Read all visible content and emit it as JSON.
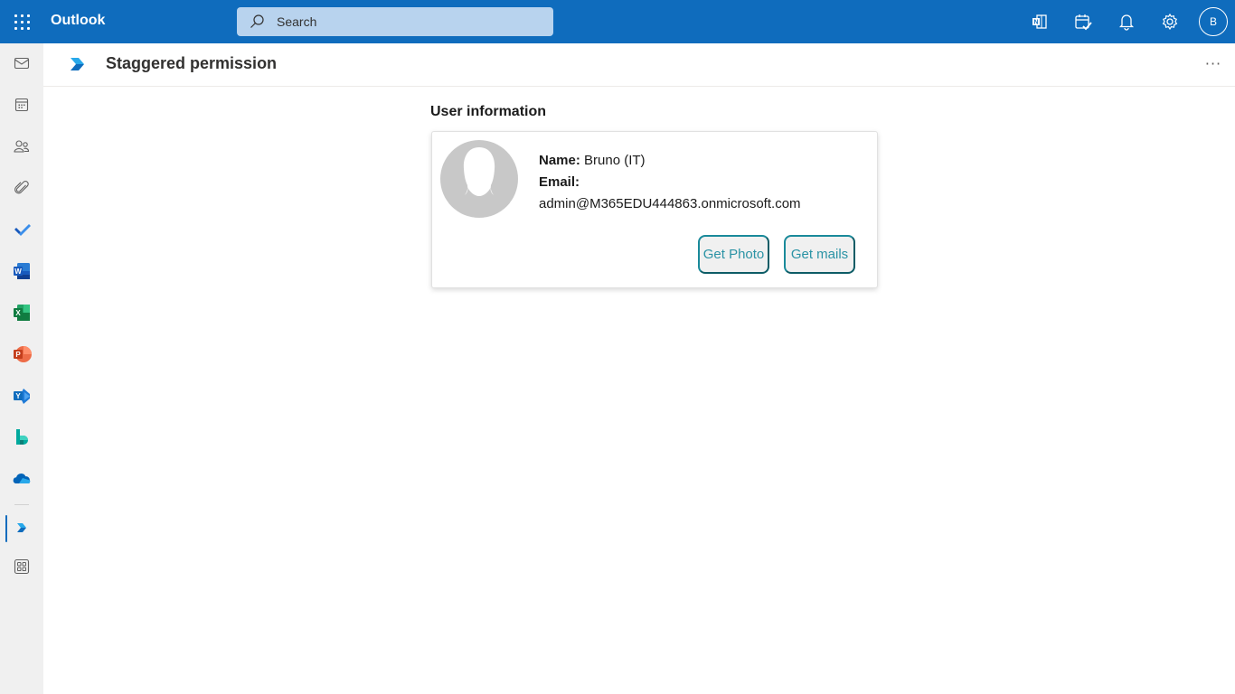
{
  "app": {
    "name": "Outlook",
    "avatar_initial": "B"
  },
  "search": {
    "placeholder": "Search",
    "value": ""
  },
  "topbar_icons": [
    "app-launcher-icon",
    "onenote-icon",
    "my-day-icon",
    "notifications-icon",
    "settings-icon"
  ],
  "left_rail": [
    {
      "name": "mail"
    },
    {
      "name": "calendar"
    },
    {
      "name": "people"
    },
    {
      "name": "files"
    },
    {
      "name": "to-do"
    },
    {
      "name": "word"
    },
    {
      "name": "excel"
    },
    {
      "name": "powerpoint"
    },
    {
      "name": "yammer"
    },
    {
      "name": "bookings"
    },
    {
      "name": "onedrive"
    },
    {
      "name": "staggered-permission-addin",
      "active": true
    },
    {
      "name": "more-apps"
    }
  ],
  "header": {
    "title": "Staggered permission",
    "more_label": "···"
  },
  "user_info": {
    "section_title": "User information",
    "name_label": "Name:",
    "name_value": "Bruno (IT)",
    "email_label": "Email:",
    "email_value": "admin@M365EDU444863.onmicrosoft.com",
    "get_photo_label": "Get Photo",
    "get_mails_label": "Get mails"
  },
  "colors": {
    "brand": "#0f6cbd",
    "button_border": "#1a8a9a",
    "button_text": "#2b93a5"
  }
}
